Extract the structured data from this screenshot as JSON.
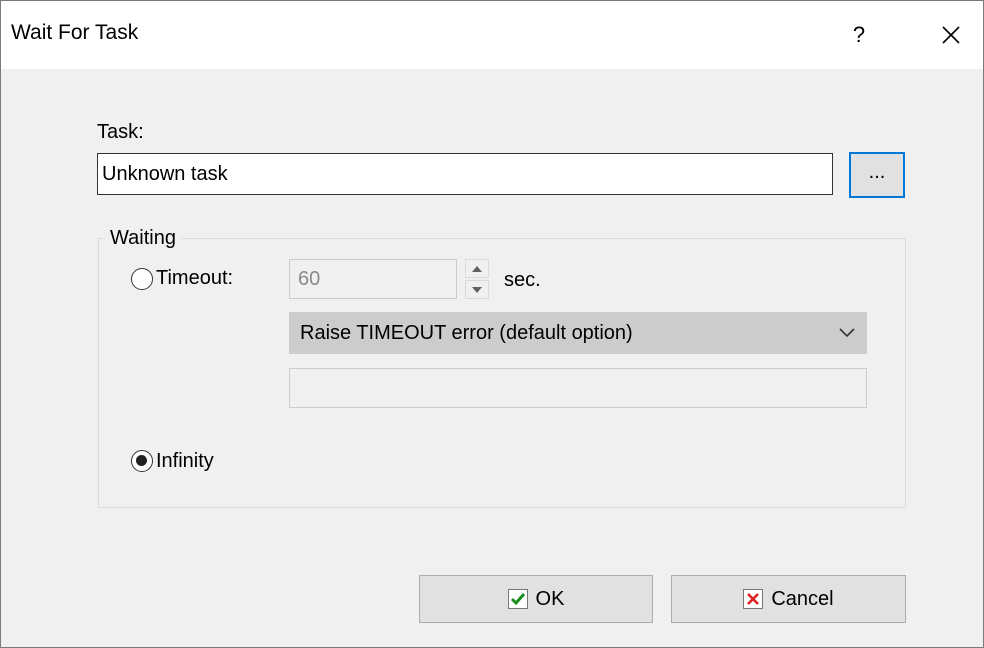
{
  "window": {
    "title": "Wait For Task",
    "help_label": "?",
    "close_icon": "close-icon"
  },
  "task": {
    "label": "Task:",
    "value": "Unknown task",
    "browse_label": "..."
  },
  "waiting": {
    "group_label": "Waiting",
    "timeout": {
      "label": "Timeout:",
      "value": "60",
      "unit": "sec.",
      "selected": false
    },
    "timeout_action": {
      "selected": "Raise TIMEOUT error (default option)"
    },
    "timeout_extra_value": "",
    "infinity": {
      "label": "Infinity",
      "selected": true
    }
  },
  "buttons": {
    "ok_label": "OK",
    "cancel_label": "Cancel"
  },
  "colors": {
    "focus_border": "#0078d7",
    "ok_check": "#1a8f1a",
    "cancel_x": "#e01f1f"
  }
}
